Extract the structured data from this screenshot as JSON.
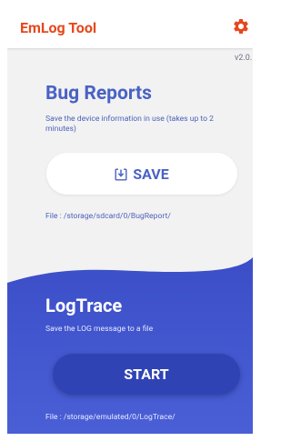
{
  "app": {
    "title": "EmLog Tool",
    "version": "v2.0.",
    "accent_color": "#e5481d",
    "settings_icon": "gear-icon"
  },
  "bug_reports": {
    "title": "Bug Reports",
    "description": "Save the device information in use (takes up to 2 minutes)",
    "button_label": "SAVE",
    "button_icon": "download-icon",
    "file_path": "File : /storage/sdcard/0/BugReport/"
  },
  "log_trace": {
    "title": "LogTrace",
    "description": "Save the LOG message to a file",
    "button_label": "START",
    "file_path": "File : /storage/emulated/0/LogTrace/",
    "panel_color": "#3f52cc"
  }
}
